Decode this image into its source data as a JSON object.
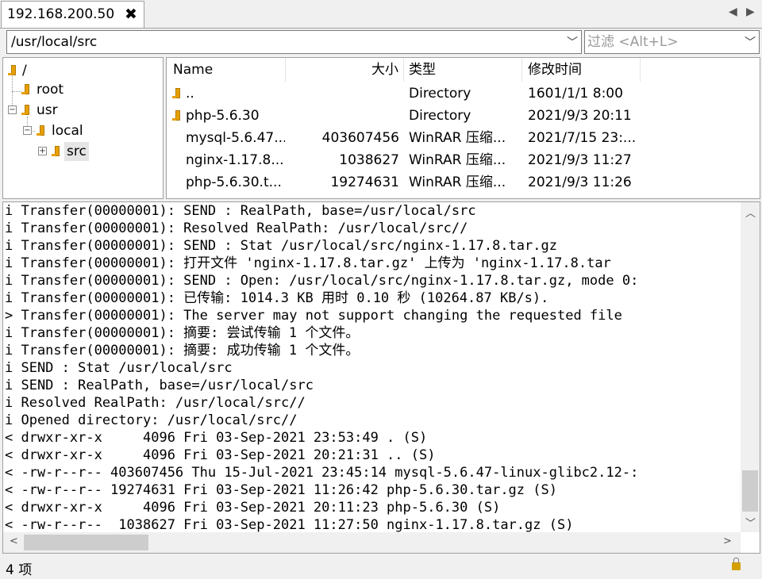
{
  "tab": {
    "title": "192.168.200.50",
    "close_glyph": "✖"
  },
  "path": {
    "value": "/usr/local/src"
  },
  "filter": {
    "placeholder": "过滤 <Alt+L>"
  },
  "tree": {
    "nodes": [
      {
        "label": "/"
      },
      {
        "label": "root"
      },
      {
        "label": "usr"
      },
      {
        "label": "local"
      },
      {
        "label": "src"
      }
    ]
  },
  "filelist": {
    "columns": [
      "Name",
      "大小",
      "类型",
      "修改时间"
    ],
    "rows": [
      {
        "name": "..",
        "size": "",
        "type": "Directory",
        "modified": "1601/1/1 8:00",
        "folder": true
      },
      {
        "name": "php-5.6.30",
        "size": "",
        "type": "Directory",
        "modified": "2021/9/3 20:11",
        "folder": true
      },
      {
        "name": "mysql-5.6.47....",
        "size": "403607456",
        "type": "WinRAR 压缩...",
        "modified": "2021/7/15 23:...",
        "folder": false
      },
      {
        "name": "nginx-1.17.8....",
        "size": "1038627",
        "type": "WinRAR 压缩...",
        "modified": "2021/9/3 11:27",
        "folder": false
      },
      {
        "name": "php-5.6.30.t...",
        "size": "19274631",
        "type": "WinRAR 压缩...",
        "modified": "2021/9/3 11:26",
        "folder": false
      }
    ]
  },
  "log": {
    "lines": [
      "i Transfer(00000001): SEND : RealPath, base=/usr/local/src",
      "i Transfer(00000001): Resolved RealPath: /usr/local/src//",
      "i Transfer(00000001): SEND : Stat /usr/local/src/nginx-1.17.8.tar.gz",
      "i Transfer(00000001): 打开文件 'nginx-1.17.8.tar.gz' 上传为 'nginx-1.17.8.tar",
      "i Transfer(00000001): SEND : Open: /usr/local/src/nginx-1.17.8.tar.gz, mode 0:",
      "i Transfer(00000001): 已传输: 1014.3 KB 用时 0.10 秒 (10264.87 KB/s).",
      "> Transfer(00000001): The server may not support changing the requested file",
      "i Transfer(00000001): 摘要: 尝试传输 1 个文件。",
      "i Transfer(00000001): 摘要: 成功传输 1 个文件。",
      "i SEND : Stat /usr/local/src",
      "i SEND : RealPath, base=/usr/local/src",
      "i Resolved RealPath: /usr/local/src//",
      "i Opened directory: /usr/local/src//",
      "< drwxr-xr-x     4096 Fri 03-Sep-2021 23:53:49 . (S)",
      "< drwxr-xr-x     4096 Fri 03-Sep-2021 20:21:31 .. (S)",
      "< -rw-r--r-- 403607456 Thu 15-Jul-2021 23:45:14 mysql-5.6.47-linux-glibc2.12-:",
      "< -rw-r--r-- 19274631 Fri 03-Sep-2021 11:26:42 php-5.6.30.tar.gz (S)",
      "< drwxr-xr-x     4096 Fri 03-Sep-2021 20:11:23 php-5.6.30 (S)",
      "< -rw-r--r--  1038627 Fri 03-Sep-2021 11:27:50 nginx-1.17.8.tar.gz (S)"
    ]
  },
  "status": {
    "text": "4 项",
    "icon": "lock-icon"
  }
}
